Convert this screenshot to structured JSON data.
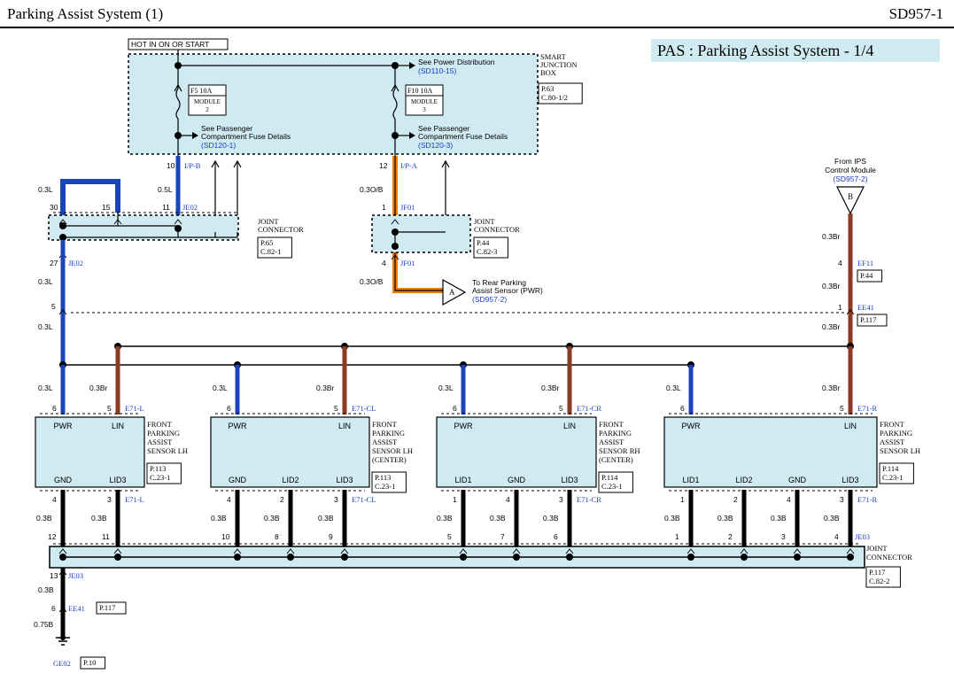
{
  "header": {
    "title": "Parking Assist System (1)",
    "code": "SD957-1"
  },
  "diagram_title": "PAS : Parking Assist System - 1/4",
  "sjb": {
    "hot_label": "HOT IN ON OR START",
    "name": [
      "SMART",
      "JUNCTION",
      "BOX"
    ],
    "ref": [
      "P.63",
      "C.80-1/2"
    ],
    "power_note": "See Power Distribution",
    "power_ref": "(SD110-15)",
    "fuse1": {
      "name": "F5 10A",
      "module": [
        "MODULE",
        "2"
      ]
    },
    "fuse2": {
      "name": "F10 10A",
      "module": [
        "MODULE",
        "3"
      ]
    },
    "detail1": [
      "See Passenger",
      "Compartment Fuse Details"
    ],
    "detail1_ref": "(SD120-1)",
    "detail2": [
      "See Passenger",
      "Compartment Fuse Details"
    ],
    "detail2_ref": "(SD120-3)"
  },
  "wires": {
    "w10": "10",
    "ipb": "I/P-B",
    "w12": "12",
    "ipa": "I/P-A",
    "l03": "0.3L",
    "l05": "0.5L",
    "o03": "0.3O/B",
    "br03": "0.3Br",
    "b03": "0.3B",
    "b075": "0.75B"
  },
  "je02": {
    "pin30": "30",
    "pin15": "15",
    "pin11": "11",
    "label": "JE02",
    "pin27": "27",
    "name": [
      "JOINT",
      "CONNECTOR"
    ],
    "ref": [
      "P.65",
      "C.82-1"
    ]
  },
  "jf01": {
    "pin1": "1",
    "label": "JF01",
    "pin4": "4",
    "name": [
      "JOINT",
      "CONNECTOR"
    ],
    "ref": [
      "P.44",
      "C.82-3"
    ]
  },
  "to_rear": {
    "letter": "A",
    "text": [
      "To Rear Parking",
      "Assist Sensor (PWR)"
    ],
    "ref": "(SD957-2)"
  },
  "from_ips": {
    "letter": "B",
    "text": [
      "From IPS",
      "Control Module"
    ],
    "ref": "(SD957-2)"
  },
  "ef11": {
    "pin": "4",
    "label": "EF11",
    "ref": "P.44"
  },
  "ee41": {
    "pin_l": "5",
    "pin_r": "1",
    "label": "EE41",
    "ref": "P.117"
  },
  "sensors": [
    {
      "conn": "E71-L",
      "name": [
        "FRONT",
        "PARKING",
        "ASSIST",
        "SENSOR LH"
      ],
      "ref": [
        "P.113",
        "C.23-1"
      ],
      "top": [
        "PWR",
        "LIN"
      ],
      "bottom": [
        "GND",
        "LID3"
      ],
      "top_pins": [
        "6",
        "5"
      ],
      "bottom_pins": [
        "4",
        "3"
      ]
    },
    {
      "conn": "E71-CL",
      "name": [
        "FRONT",
        "PARKING",
        "ASSIST",
        "SENSOR LH",
        "(CENTER)"
      ],
      "ref": [
        "P.113",
        "C.23-1"
      ],
      "top": [
        "PWR",
        "LIN"
      ],
      "bottom": [
        "GND",
        "LID2",
        "LID3"
      ],
      "top_pins": [
        "6",
        "5"
      ],
      "bottom_pins": [
        "4",
        "2",
        "3"
      ]
    },
    {
      "conn": "E71-CR",
      "name": [
        "FRONT",
        "PARKING",
        "ASSIST",
        "SENSOR RH",
        "(CENTER)"
      ],
      "ref": [
        "P.114",
        "C.23-1"
      ],
      "top": [
        "PWR",
        "LIN"
      ],
      "bottom": [
        "LID1",
        "GND",
        "LID3"
      ],
      "top_pins": [
        "6",
        "5"
      ],
      "bottom_pins": [
        "1",
        "4",
        "3"
      ]
    },
    {
      "conn": "E71-R",
      "name": [
        "FRONT",
        "PARKING",
        "ASSIST",
        "SENSOR LH"
      ],
      "ref": [
        "P.114",
        "C.23-1"
      ],
      "top": [
        "PWR",
        "LIN"
      ],
      "bottom": [
        "LID1",
        "LID2",
        "GND",
        "LID3"
      ],
      "top_pins": [
        "6",
        "5"
      ],
      "bottom_pins": [
        "1",
        "2",
        "4",
        "3"
      ]
    }
  ],
  "je03": {
    "label": "JE03",
    "pins": [
      "12",
      "11",
      "10",
      "8",
      "9",
      "5",
      "7",
      "6",
      "1",
      "2",
      "3",
      "4"
    ],
    "pin13": "13",
    "name": [
      "JOINT",
      "CONNECTOR"
    ],
    "ref": [
      "P.117",
      "C.82-2"
    ]
  },
  "ground": {
    "pin": "6",
    "conn": "EE41",
    "conn_ref": "P.117",
    "label": "GE02",
    "ref": "P.10"
  },
  "colors": {
    "blue": "#1a44b8",
    "brown": "#8b3a24",
    "orange": "#f07e0c",
    "black": "#000000",
    "box": "#cfeaf1",
    "ref_blue": "#1a3cc8"
  }
}
